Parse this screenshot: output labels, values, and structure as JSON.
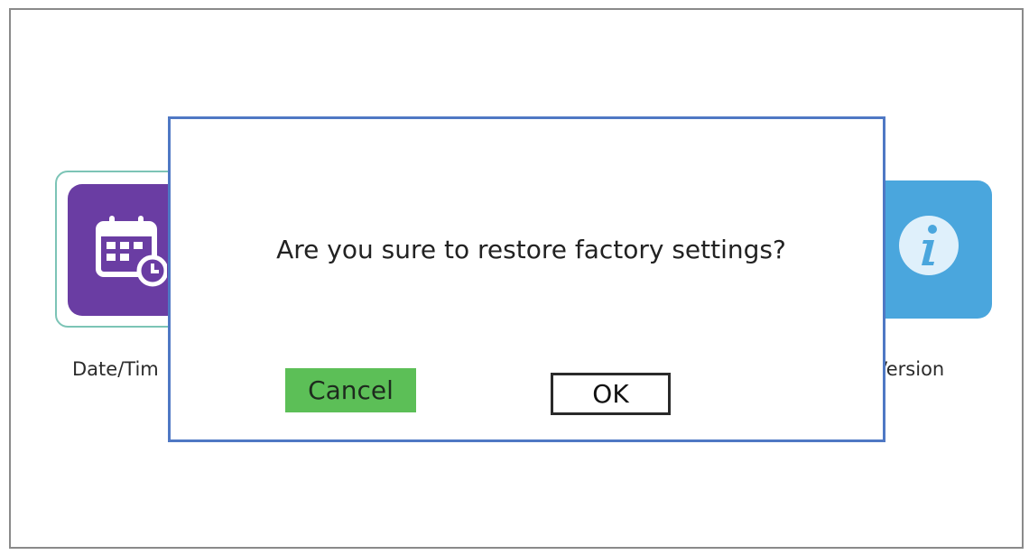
{
  "background_tiles": {
    "datetime": {
      "label": "Date/Tim",
      "icon": "calendar-clock-icon",
      "color": "#6a3da3"
    },
    "version": {
      "label": "Version",
      "icon": "info-icon",
      "color": "#4aa6dd"
    },
    "selection_color": "#7cc4b6"
  },
  "dialog": {
    "message": "Are you sure to restore factory settings?",
    "cancel_label": "Cancel",
    "ok_label": "OK",
    "border_color": "#4f78c4",
    "cancel_color": "#5cbf57"
  }
}
